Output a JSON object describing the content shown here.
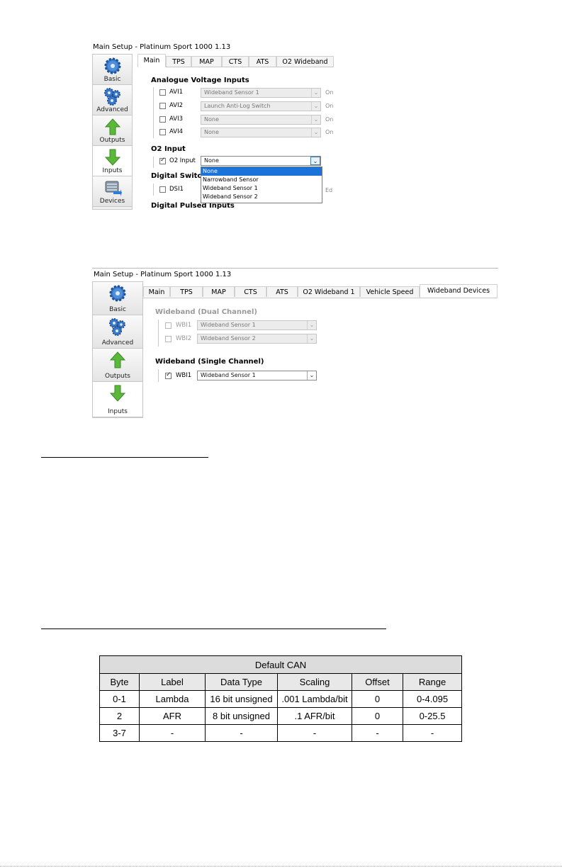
{
  "shot1": {
    "title": "Main Setup - Platinum Sport 1000 1.13",
    "sidebar": [
      "Basic",
      "Advanced",
      "Outputs",
      "Inputs",
      "Devices"
    ],
    "tabs": [
      "Main",
      "TPS",
      "MAP",
      "CTS",
      "ATS",
      "O2 Wideband"
    ],
    "active_tab": "Main",
    "analogue_heading": "Analogue Voltage Inputs",
    "analogue_rows": [
      {
        "label": "AVI1",
        "value": "Wideband Sensor 1",
        "suffix": "On"
      },
      {
        "label": "AVI2",
        "value": "Launch Anti-Log Switch",
        "suffix": "On"
      },
      {
        "label": "AVI3",
        "value": "None",
        "suffix": "On"
      },
      {
        "label": "AVI4",
        "value": "None",
        "suffix": "On"
      }
    ],
    "o2_heading": "O2 Input",
    "o2_label": "O2 Input",
    "o2_value": "None",
    "o2_options": [
      "None",
      "Narrowband Sensor",
      "Wideband Sensor 1",
      "Wideband Sensor 2"
    ],
    "digital_switch_heading": "Digital Switche",
    "dsi_label": "DSI1",
    "dsi_suffix": "Ed",
    "digital_pulsed_heading": "Digital Pulsed Inputs"
  },
  "shot2": {
    "title": "Main Setup - Platinum Sport 1000 1.13",
    "sidebar": [
      "Basic",
      "Advanced",
      "Outputs",
      "Inputs"
    ],
    "tabs": [
      "Main",
      "TPS",
      "MAP",
      "CTS",
      "ATS",
      "O2 Wideband 1",
      "Vehicle Speed",
      "Wideband Devices"
    ],
    "active_tab": "Wideband Devices",
    "dual_heading": "Wideband (Dual Channel)",
    "dual_rows": [
      {
        "label": "WBI1",
        "value": "Wideband Sensor 1"
      },
      {
        "label": "WBI2",
        "value": "Wideband Sensor 2"
      }
    ],
    "single_heading": "Wideband (Single Channel)",
    "single_row": {
      "label": "WBI1",
      "value": "Wideband Sensor 1"
    }
  },
  "can_table": {
    "title": "Default CAN",
    "headers": [
      "Byte",
      "Label",
      "Data Type",
      "Scaling",
      "Offset",
      "Range"
    ],
    "rows": [
      [
        "0-1",
        "Lambda",
        "16 bit unsigned",
        ".001 Lambda/bit",
        "0",
        "0-4.095"
      ],
      [
        "2",
        "AFR",
        "8 bit unsigned",
        ".1 AFR/bit",
        "0",
        "0-25.5"
      ],
      [
        "3-7",
        "-",
        "-",
        "-",
        "-",
        "-"
      ]
    ]
  }
}
